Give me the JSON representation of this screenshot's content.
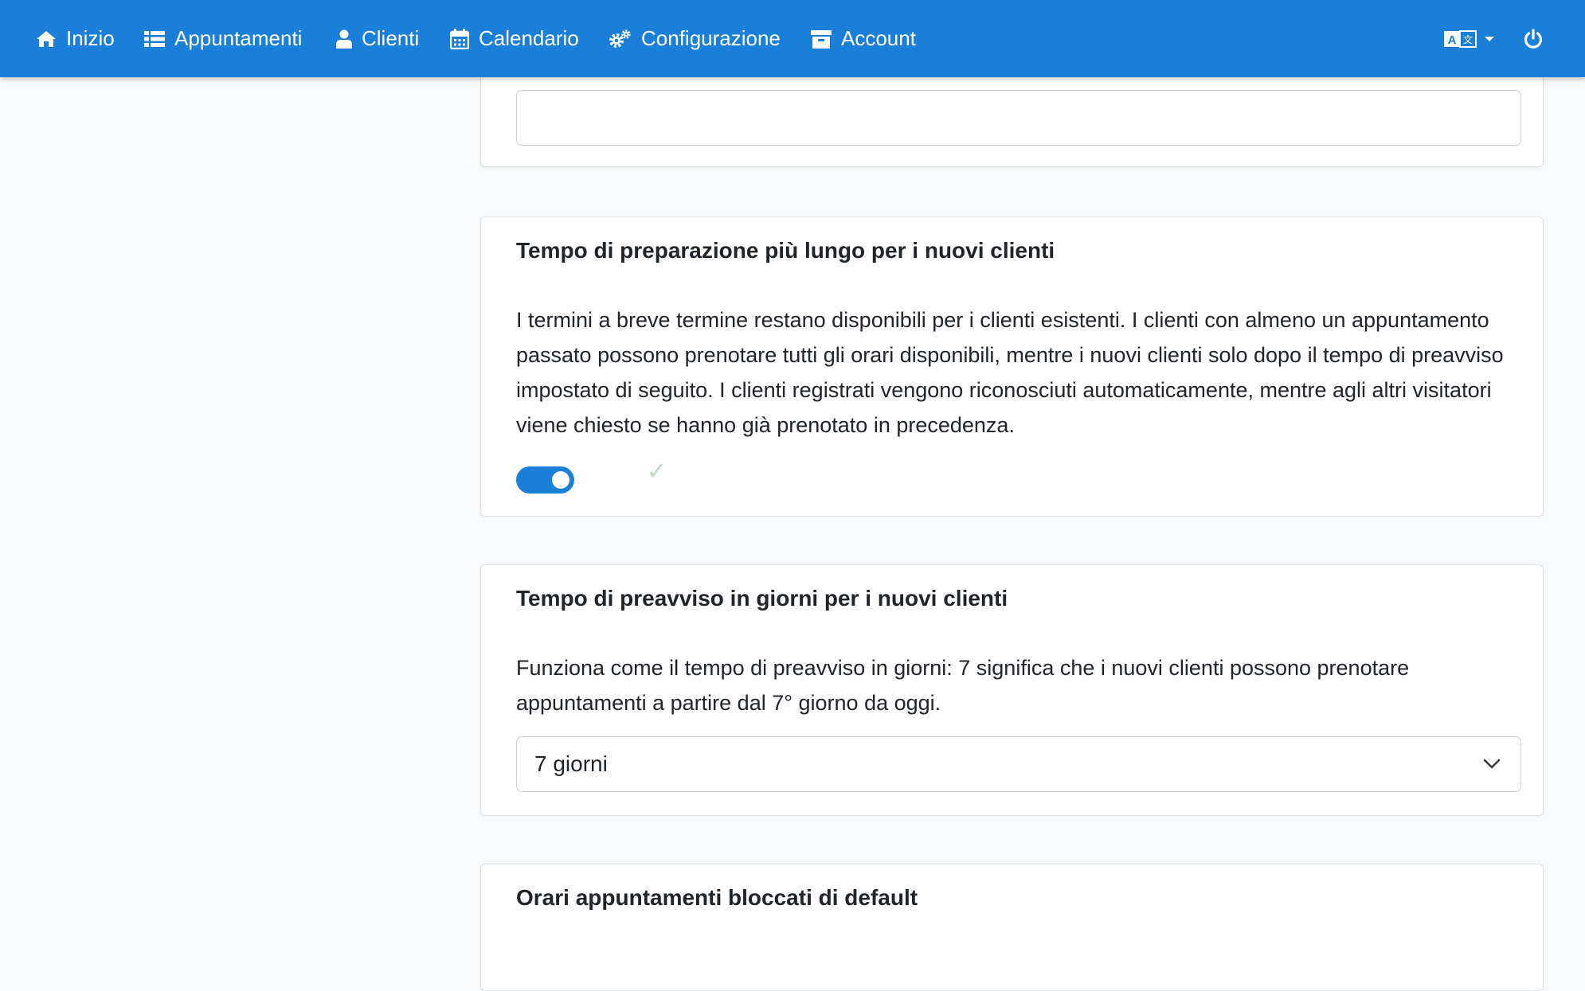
{
  "navbar": {
    "items": [
      {
        "label": "Inizio",
        "icon": "home-icon"
      },
      {
        "label": "Appuntamenti",
        "icon": "list-icon"
      },
      {
        "label": "Clienti",
        "icon": "user-icon"
      },
      {
        "label": "Calendario",
        "icon": "calendar-icon"
      },
      {
        "label": "Configurazione",
        "icon": "cogs-icon"
      },
      {
        "label": "Account",
        "icon": "archive-icon"
      }
    ],
    "language_icon": "language-icon",
    "power_icon": "power-icon",
    "color": "#1a7fd9"
  },
  "cards": {
    "top_input": {
      "value": ""
    },
    "preparation_time": {
      "title": "Tempo di preparazione più lungo per i nuovi clienti",
      "description": "I termini a breve termine restano disponibili per i clienti esistenti. I clienti con almeno un appuntamento passato possono prenotare tutti gli orari disponibili, mentre i nuovi clienti solo dopo il tempo di preavviso impostato di seguito. I clienti registrati vengono riconosciuti automaticamente, mentre agli altri visitatori viene chiesto se hanno già prenotato in precedenza.",
      "toggle_on": true,
      "saved_mark": "✓"
    },
    "notice_days": {
      "title": "Tempo di preavviso in giorni per i nuovi clienti",
      "description": "Funziona come il tempo di preavviso in giorni: 7 significa che i nuovi clienti possono prenotare appuntamenti a partire dal 7° giorno da oggi.",
      "selected": "7 giorni"
    },
    "blocked_hours": {
      "title": "Orari appuntamenti bloccati di default"
    }
  }
}
